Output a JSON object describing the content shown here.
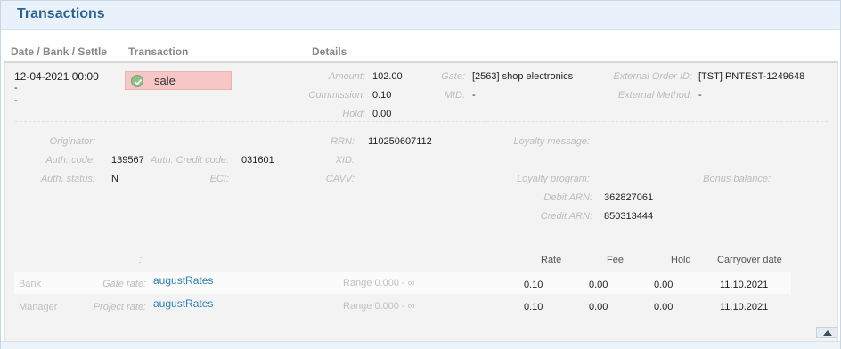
{
  "panel": {
    "title": "Transactions"
  },
  "columns": {
    "date_bank_settle": "Date / Bank / Settle",
    "transaction": "Transaction",
    "details": "Details"
  },
  "row": {
    "date": "12-04-2021 00:00",
    "bank": "-",
    "settle": "-",
    "transaction_type": "sale",
    "status_icon": "check-circle-icon",
    "amount_label": "Amount:",
    "amount": "102.00",
    "commission_label": "Commission:",
    "commission": "0.10",
    "hold_label": "Hold:",
    "hold": "0.00",
    "gate_label": "Gate:",
    "gate": "[2563] shop electronics",
    "mid_label": "MID:",
    "mid": "-",
    "external_order_label": "External Order ID:",
    "external_order": "[TST] PNTEST-1249648",
    "external_method_label": "External Method:",
    "external_method": "-"
  },
  "details": {
    "originator_label": "Originator:",
    "auth_code_label": "Auth. code:",
    "auth_code": "139567",
    "auth_credit_label": "Auth. Credit code:",
    "auth_credit": "031601",
    "auth_status_label": "Auth. status:",
    "auth_status": "N",
    "eci_label": "ECI:",
    "rrn_label": "RRN:",
    "rrn": "110250607112",
    "xid_label": "XID:",
    "cavv_label": "CAVV:",
    "loyalty_message_label": "Loyalty message:",
    "loyalty_program_label": "Loyalty program:",
    "bonus_balance_label": "Bonus balance:",
    "debit_arn_label": "Debit ARN:",
    "debit_arn": "362827061",
    "credit_arn_label": "Credit ARN:",
    "credit_arn": "850313444"
  },
  "rates": {
    "colon": ":",
    "headers": {
      "rate": "Rate",
      "fee": "Fee",
      "hold": "Hold",
      "carryover": "Carryover date"
    },
    "rows": [
      {
        "party": "Bank",
        "rate_label": "Gate rate:",
        "rate_name": "augustRates",
        "range": "Range 0.000 - ∞",
        "rate": "0.10",
        "fee": "0.00",
        "hold": "0.00",
        "carryover": "11.10.2021"
      },
      {
        "party": "Manager",
        "rate_label": "Project rate:",
        "rate_name": "augustRates",
        "range": "Range 0.000 - ∞",
        "rate": "0.10",
        "fee": "0.00",
        "hold": "0.00",
        "carryover": "11.10.2021"
      }
    ]
  },
  "colors": {
    "title": "#2a6496",
    "link": "#2a80b9",
    "sale_badge": "#f7c6c6",
    "status_ok": "#8fbf8a"
  }
}
